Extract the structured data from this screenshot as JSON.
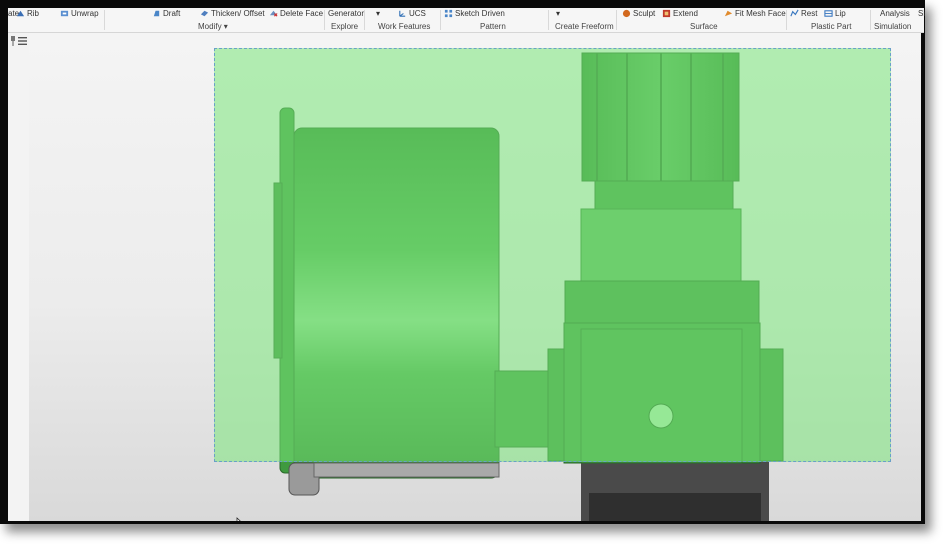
{
  "ribbon": {
    "buttons": [
      {
        "label": "ate",
        "icon": ""
      },
      {
        "label": "Rib",
        "icon": "rib-icon"
      },
      {
        "label": "Unwrap",
        "icon": "unwrap-icon"
      },
      {
        "label": "Draft",
        "icon": "draft-icon"
      },
      {
        "label": "Thicken/ Offset",
        "icon": "thicken-offset-icon"
      },
      {
        "label": "Delete Face",
        "icon": "delete-face-icon"
      },
      {
        "label": "Generator",
        "icon": ""
      },
      {
        "label": "UCS",
        "icon": "ucs-icon"
      },
      {
        "label": "Sketch Driven",
        "icon": "sketch-driven-icon"
      },
      {
        "label": "Sculpt",
        "icon": "sculpt-icon"
      },
      {
        "label": "Extend",
        "icon": "extend-icon"
      },
      {
        "label": "Fit Mesh Face",
        "icon": "fit-mesh-face-icon"
      },
      {
        "label": "Rest",
        "icon": "rest-icon"
      },
      {
        "label": "Lip",
        "icon": "lip-icon"
      },
      {
        "label": "Analysis",
        "icon": ""
      },
      {
        "label": "Si",
        "icon": ""
      }
    ],
    "groups": [
      {
        "label": "Modify ▾"
      },
      {
        "label": "Explore"
      },
      {
        "label": "Work Features"
      },
      {
        "label": "Pattern"
      },
      {
        "label": "Create Freeform"
      },
      {
        "label": "Surface"
      },
      {
        "label": "Plastic Part"
      },
      {
        "label": "Simulation"
      }
    ]
  },
  "left_strip": {
    "icons": [
      "pin-icon",
      "menu-icon"
    ]
  },
  "viewport": {
    "accent_selection": "#7ae67a",
    "model_color": "#3f9a3f"
  }
}
